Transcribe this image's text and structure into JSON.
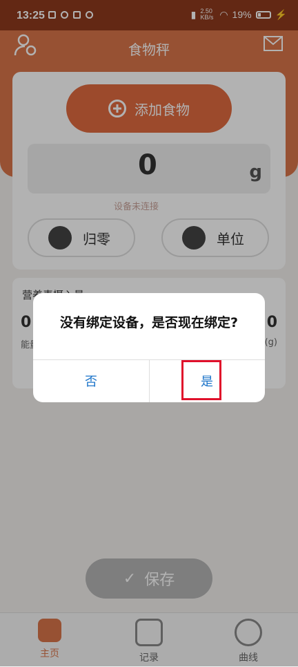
{
  "status_bar": {
    "time": "13:25",
    "net_speed": "2.50 KB/s",
    "battery": "19%"
  },
  "header": {
    "title": "食物秤",
    "user_icon": "user-gear-icon",
    "mail_icon": "mail-icon"
  },
  "scale": {
    "add_food": "添加食物",
    "weight_value": "0",
    "weight_unit": "g",
    "hint": "设备未连接"
  },
  "actions": {
    "zero_label": "归零",
    "unit_label": "单位"
  },
  "nutrition": {
    "title": "营养素摄入量",
    "left_value": "0",
    "left_label": "能量",
    "right_value": "0",
    "right_label": "(g)"
  },
  "save_label": "保存",
  "tabs": [
    {
      "label": "主页"
    },
    {
      "label": "记录"
    },
    {
      "label": "曲线"
    }
  ],
  "dialog": {
    "message": "没有绑定设备，是否现在绑定?",
    "no_label": "否",
    "yes_label": "是"
  },
  "colors": {
    "accent": "#e06a3f",
    "header_bg": "#d9744a",
    "highlight": "#e0102b",
    "link_blue": "#1a73c9"
  }
}
